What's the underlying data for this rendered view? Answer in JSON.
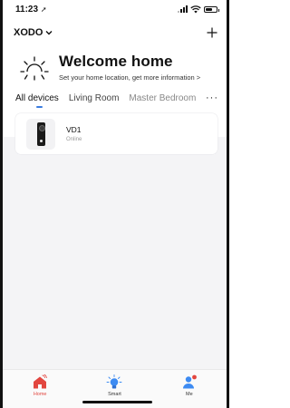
{
  "status_bar": {
    "time": "11:23"
  },
  "header": {
    "home_name": "XODO"
  },
  "welcome": {
    "title": "Welcome home",
    "subtitle": "Set your home location, get more information >"
  },
  "rooms": {
    "tabs": [
      {
        "label": "All devices",
        "active": true
      },
      {
        "label": "Living Room",
        "active": false
      },
      {
        "label": "Master Bedroom",
        "active": false
      }
    ],
    "more": "···"
  },
  "devices": [
    {
      "name": "VD1",
      "status": "Online",
      "icon": "doorbell-icon"
    }
  ],
  "tab_bar": {
    "items": [
      {
        "label": "Home",
        "icon": "home-icon",
        "active": true
      },
      {
        "label": "Smart",
        "icon": "smart-bulb-icon",
        "active": false
      },
      {
        "label": "Me",
        "icon": "profile-icon",
        "active": false
      }
    ]
  },
  "colors": {
    "accent": "#e2463f",
    "tab_indicator": "#3a7be0",
    "smart_icon": "#3d8bf2",
    "me_icon": "#3d8bf2"
  }
}
